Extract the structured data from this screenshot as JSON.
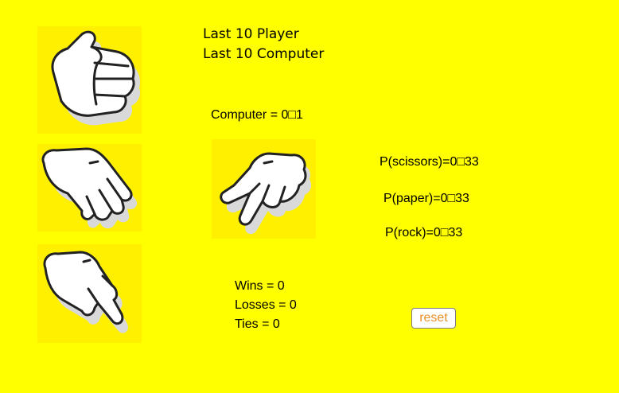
{
  "history": {
    "player_label": "Last 10 Player",
    "computer_label": "Last 10 Computer"
  },
  "computer_choice": "Computer = 0□1",
  "probabilities": {
    "scissors": "P(scissors)=0□33",
    "paper": "P(paper)=0□33",
    "rock": "P(rock)=0□33"
  },
  "score": {
    "wins": "Wins = 0",
    "losses": "Losses = 0",
    "ties": "Ties = 0"
  },
  "reset_label": "reset",
  "choices": [
    "rock",
    "paper",
    "scissors"
  ],
  "colors": {
    "background": "#ffff00",
    "tile": "#fff000",
    "reset_text": "#e8902a"
  }
}
